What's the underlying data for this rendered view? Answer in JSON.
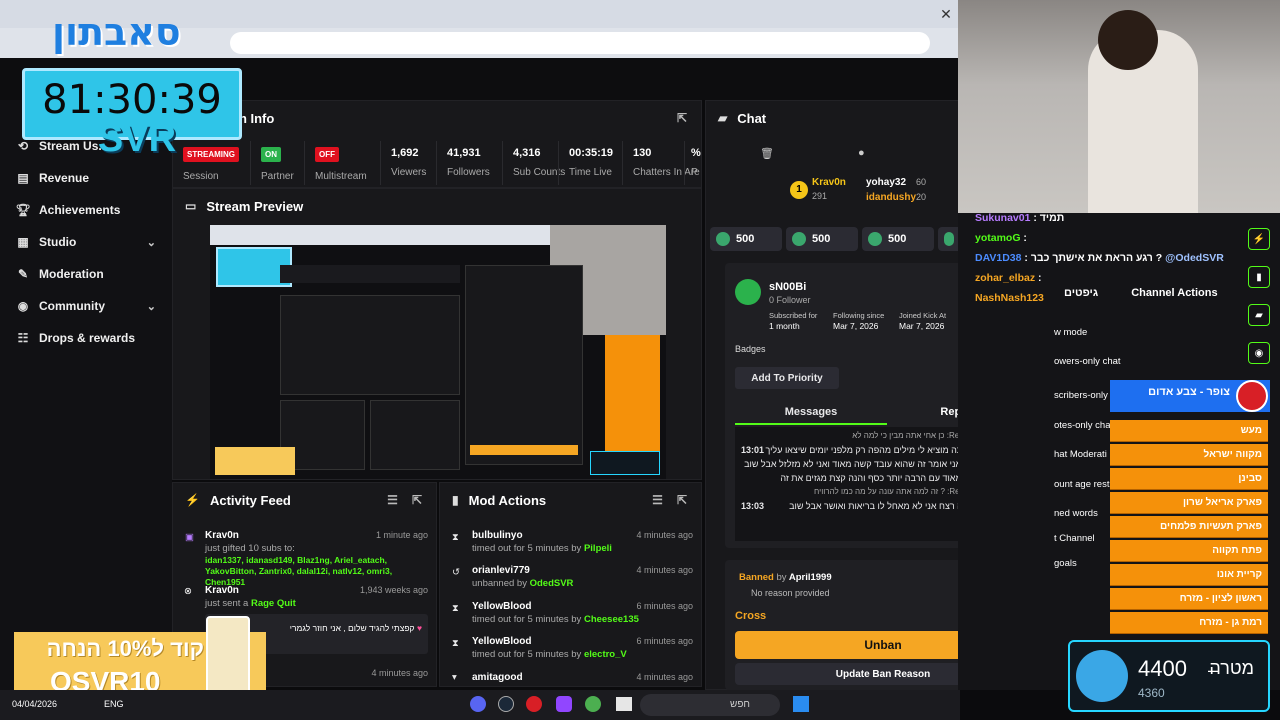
{
  "overlay": {
    "timer": "81:30:39",
    "brand": "SVR",
    "logo_text": "סאבתון",
    "promo_line1": "קוד ל10% הנחה",
    "promo_line2": "OSVR10",
    "goal_title": "מטרה",
    "goal_current": "4400",
    "goal_prev": "4360"
  },
  "sidebar": {
    "items": [
      {
        "label": "Stream Us...",
        "icon": "broadcast-icon"
      },
      {
        "label": "Revenue",
        "icon": "chart-icon"
      },
      {
        "label": "Achievements",
        "icon": "trophy-icon"
      },
      {
        "label": "Studio",
        "icon": "studio-icon"
      },
      {
        "label": "Moderation",
        "icon": "wrench-icon"
      },
      {
        "label": "Community",
        "icon": "community-icon"
      },
      {
        "label": "Drops & rewards",
        "icon": "gift-icon"
      }
    ]
  },
  "stream_info": {
    "title": "on Info",
    "session": {
      "status": "STREAMING",
      "label": "Session"
    },
    "partner": {
      "status": "ON",
      "label": "Partner"
    },
    "multistream": {
      "status": "OFF",
      "label": "Multistream"
    },
    "stats": [
      {
        "value": "1,692",
        "label": "Viewers"
      },
      {
        "value": "41,931",
        "label": "Followers"
      },
      {
        "value": "4,316",
        "label": "Sub Counts"
      },
      {
        "value": "00:35:19",
        "label": "Time Live"
      },
      {
        "value": "130",
        "label": "Chatters In Are"
      },
      {
        "value": "%",
        "label": "P"
      }
    ]
  },
  "preview": {
    "title": "Stream Preview"
  },
  "activity": {
    "title": "Activity Feed",
    "items": [
      {
        "name": "Krav0n",
        "time": "1 minute ago",
        "text": "just gifted 10 subs to:",
        "names": "idan1337, idanasd149, Blaz1ng, Ariel_eatach, YakovBitton, Zantrix0, dalal12i, natlv12, omri3, Chen1951"
      },
      {
        "name": "Krav0n",
        "time": "1,943 weeks ago",
        "text": "just sent a",
        "gift": "Rage Quit",
        "msg": "קפצתי להגיד שלום , אני חוזר לגמרי"
      },
      {
        "name": "...ero",
        "time": "4 minutes ago"
      }
    ]
  },
  "mod_actions": {
    "title": "Mod Actions",
    "items": [
      {
        "name": "bulbulinyo",
        "time": "4 minutes ago",
        "action": "timed out for 5 minutes by",
        "by": "Pilpeli"
      },
      {
        "name": "orianlevi779",
        "time": "4 minutes ago",
        "action": "unbanned by",
        "by": "OdedSVR"
      },
      {
        "name": "YellowBlood",
        "time": "6 minutes ago",
        "action": "timed out for 5 minutes by",
        "by": "Cheesee135"
      },
      {
        "name": "YellowBlood",
        "time": "6 minutes ago",
        "action": "timed out for 5 minutes by",
        "by": "electro_V"
      },
      {
        "name": "amitagood",
        "time": "4 minutes ago",
        "action": "",
        "by": ""
      }
    ]
  },
  "chat": {
    "title": "Chat",
    "top_gifters": [
      {
        "name": "Krav0n",
        "count": "291"
      },
      {
        "name": "yohay32",
        "count": "60"
      },
      {
        "name": "idandushy",
        "count": "20"
      }
    ],
    "badges": [
      "500",
      "500",
      "500",
      "500"
    ],
    "user_card": {
      "username": "sN00Bi",
      "followers": "0 Follower",
      "subscribed_label": "Subscribed for",
      "subscribed_value": "1 month",
      "following_label": "Following since",
      "following_value": "Mar 7, 2026",
      "joined_label": "Joined Kick At",
      "joined_value": "Mar 7, 2026",
      "badges_label": "Badges",
      "priority_button": "Add To Priority",
      "tab_messages": "Messages",
      "tab_replies": "Replies",
      "messages": [
        {
          "time": "",
          "text": "Replying to electro_V: כן אחי אתה מבין כי למה לא"
        },
        {
          "time": "13:01",
          "text": "שמע אתה הזוי אתה מוציא לי מילים מהפה רק מלפני יומים שיצאו עליך סירגנתי לך מה שאני אומר זה שהוא עובד קשה מאוד ואני לא מזלזל אבל שוב יש עבודות קשות מאוד עם הרבה יותר כסף והנה קצת מגזים את זה"
        },
        {
          "time": "",
          "text": "Replying to April1999: ? זה למה אתה עונה על מה כמו להרוויח"
        },
        {
          "time": "13:03",
          "text": "שומעת את מזדרה רצח אני לא מאחל לו בריאות ואושר אבל שוב"
        }
      ]
    },
    "ban": {
      "banned_label": "Banned",
      "by_label": "by",
      "banned_by": "April1999",
      "reason": "No reason provided",
      "cross_label": "Cross",
      "unban_button": "Unban",
      "update_button": "Update Ban Reason"
    }
  },
  "channel_actions": {
    "title": "Channel Actions",
    "header_left": "גיפטים",
    "items": [
      "w mode",
      "owers-only chat",
      "scribers-only",
      "otes-only cha",
      "hat Moderati",
      "ount age rest",
      "ned words",
      "t Channel",
      "goals"
    ]
  },
  "stream_chat": [
    {
      "name": "Sukunav01",
      "text": "תמיד"
    },
    {
      "name": "yotamoG",
      "text": ""
    },
    {
      "name": "DAV1D38",
      "text": "רגע הראת את אישתך כבר ?",
      "mention": "@OdedSVR"
    },
    {
      "name": "zohar_elbaz",
      "text": ""
    },
    {
      "name": "NashNash123",
      "text": "כולם ערוצים"
    }
  ],
  "leaderboard": {
    "header": "צופר - צבע אדום",
    "rows": [
      "מעש",
      "מקווה ישראל",
      "סבינן",
      "פארק אריאל שרון",
      "פארק תעשיות פלמחים",
      "פתח תקווה",
      "קריית אונו",
      "ראשון לציון - מזרח",
      "רמת גן - מזרח"
    ]
  },
  "taskbar": {
    "date": "04/04/2026",
    "lang": "ENG",
    "search": "חפש"
  },
  "colors": {
    "accent": "#53fc18",
    "orange": "#f5a623",
    "panel": "#18181b"
  }
}
